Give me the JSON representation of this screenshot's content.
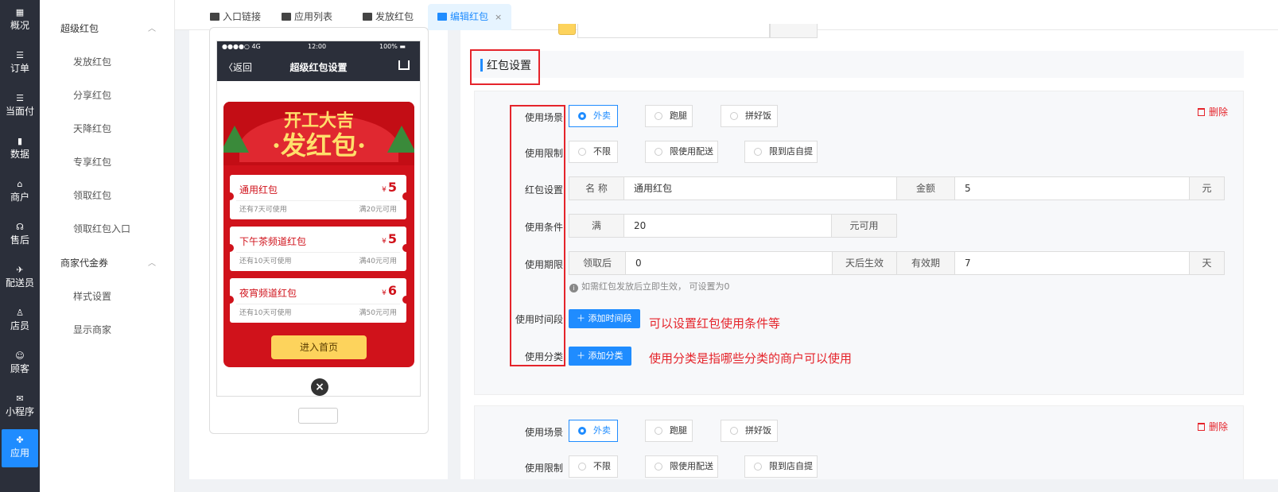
{
  "rail": {
    "items": [
      {
        "icon": "▦",
        "label": "概况"
      },
      {
        "icon": "☰",
        "label": "订单"
      },
      {
        "icon": "☰",
        "label": "当面付"
      },
      {
        "icon": "▮",
        "label": "数据"
      },
      {
        "icon": "⌂",
        "label": "商户"
      },
      {
        "icon": "☊",
        "label": "售后"
      },
      {
        "icon": "✈",
        "label": "配送员"
      },
      {
        "icon": "♙",
        "label": "店员"
      },
      {
        "icon": "☺",
        "label": "顾客"
      },
      {
        "icon": "✉",
        "label": "小程序"
      },
      {
        "icon": "✤",
        "label": "应用"
      }
    ]
  },
  "subside": {
    "group1": "超级红包",
    "group1_items": [
      "发放红包",
      "分享红包",
      "天降红包",
      "专享红包",
      "领取红包",
      "领取红包入口"
    ],
    "group2": "商家代金券",
    "group2_items": [
      "样式设置",
      "显示商家"
    ]
  },
  "tabs": [
    {
      "label": "入口链接"
    },
    {
      "label": "应用列表"
    },
    {
      "label": "发放红包"
    },
    {
      "label": "编辑红包",
      "close": "×"
    }
  ],
  "phone": {
    "signal": "●●●●○ 4G",
    "time": "12:00",
    "battery": "100% ▬",
    "back": "〈返回",
    "title": "超级红包设置",
    "banner_line1": "开工大吉",
    "banner_line2": "·发红包·",
    "coupons": [
      {
        "name": "通用红包",
        "currency": "¥",
        "amount": "5",
        "valid": "还有7天可使用",
        "cond": "满20元可用"
      },
      {
        "name": "下午茶频道红包",
        "currency": "¥",
        "amount": "5",
        "valid": "还有10天可使用",
        "cond": "满40元可用"
      },
      {
        "name": "夜宵频道红包",
        "currency": "¥",
        "amount": "6",
        "valid": "还有10天可使用",
        "cond": "满50元可用"
      }
    ],
    "enter": "进入首页",
    "close": "×"
  },
  "form": {
    "section_title": "红包设置",
    "delete": "删除",
    "labels": {
      "scene": "使用场景",
      "limit": "使用限制",
      "setting": "红包设置",
      "condition": "使用条件",
      "period": "使用期限",
      "timeslot": "使用时间段",
      "category": "使用分类"
    },
    "scene_options": [
      "外卖",
      "跑腿",
      "拼好饭"
    ],
    "limit_options": [
      "不限",
      "限使用配送",
      "限到店自提"
    ],
    "name_addon": "名 称",
    "name_value": "通用红包",
    "amount_addon": "金额",
    "amount_value": "5",
    "amount_unit": "元",
    "cond_prefix": "满",
    "cond_value": "20",
    "cond_suffix": "元可用",
    "period_prefix": "领取后",
    "period_value": "0",
    "period_mid": "天后生效",
    "valid_addon": "有效期",
    "valid_value": "7",
    "valid_unit": "天",
    "hint": "如需红包发放后立即生效， 可设置为0",
    "add_timeslot": "＋ 添加时间段",
    "add_category": "＋ 添加分类",
    "annot1": "可以设置红包使用条件等",
    "annot2": "使用分类是指哪些分类的商户可以使用"
  },
  "colors": {
    "accent": "#1f8cff",
    "annotation": "#e5242b",
    "rail": "#2b2f3a",
    "packet_red": "#d0121b",
    "button_gold": "#fdd35c"
  }
}
